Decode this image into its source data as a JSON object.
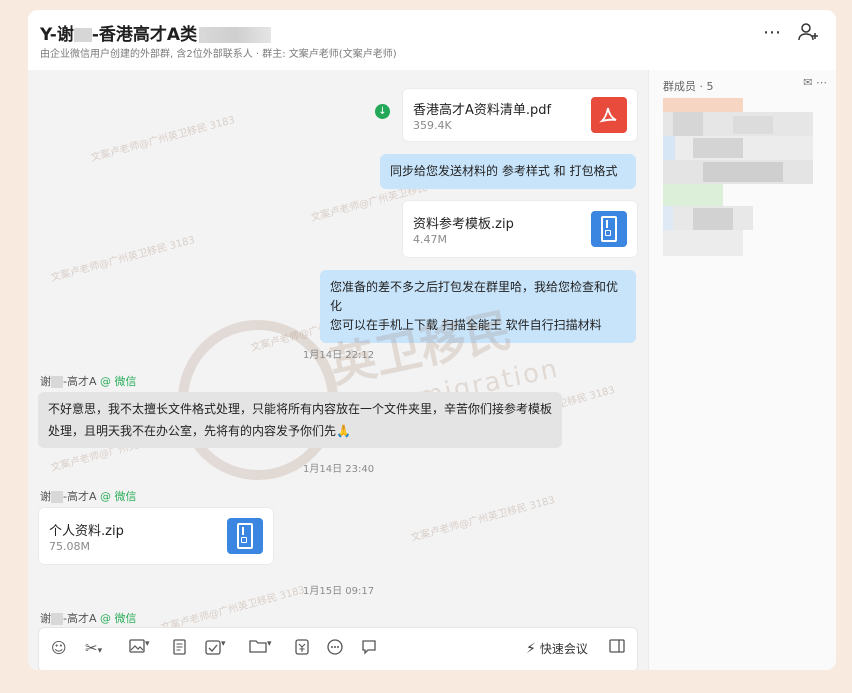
{
  "header": {
    "title_prefix": "Y-谢",
    "title_main": "-香港高才A类",
    "subtitle": "由企业微信用户创建的外部群, 含2位外部联系人 · 群主: 文案卢老师(文案卢老师)",
    "more_icon": "ellipsis-icon",
    "add_member_icon": "add-person-icon"
  },
  "sidebar": {
    "title": "群成员 · 5",
    "icons": [
      "mail-icon",
      "ellipsis-icon"
    ]
  },
  "messages": [
    {
      "type": "file",
      "direction": "out",
      "name": "香港高才A资料清单.pdf",
      "size": "359.4K",
      "icon": "pdf-icon"
    },
    {
      "type": "text",
      "direction": "out",
      "text": "同步给您发送材料的  参考样式  和  打包格式"
    },
    {
      "type": "file",
      "direction": "out",
      "name": "资料参考模板.zip",
      "size": "4.47M",
      "icon": "zip-icon"
    },
    {
      "type": "text",
      "direction": "out",
      "lines": [
        "您准备的差不多之后打包发在群里哈，我给您检查和优化",
        "您可以在手机上下载   扫描全能王   软件自行扫描材料"
      ]
    },
    {
      "type": "timestamp",
      "text": "1月14日 22:12"
    },
    {
      "type": "sender",
      "name_prefix": "谢",
      "name_suffix": "-高才A",
      "badge": "@ 微信"
    },
    {
      "type": "text",
      "direction": "in",
      "lines": [
        "不好意思，我不太擅长文件格式处理，只能将所有内容放在一个文件夹里，辛苦你们接参考模板",
        "处理，且明天我不在办公室，先将有的内容发予你们先🙏"
      ]
    },
    {
      "type": "timestamp",
      "text": "1月14日 23:40"
    },
    {
      "type": "sender",
      "name_prefix": "谢",
      "name_suffix": "-高才A",
      "badge": "@ 微信"
    },
    {
      "type": "file",
      "direction": "in",
      "name": "个人资料.zip",
      "size": "75.08M",
      "icon": "zip-icon"
    },
    {
      "type": "timestamp",
      "text": "1月15日 09:17"
    },
    {
      "type": "sender",
      "name_prefix": "谢",
      "name_suffix": "-高才A",
      "badge": "@ 微信"
    }
  ],
  "toolbar": {
    "meeting_label": "快速会议"
  },
  "watermark": {
    "main": "英卫移民",
    "sub": "Yingwei immigration",
    "faint": "文案卢老师@广州英卫移民 3183"
  }
}
